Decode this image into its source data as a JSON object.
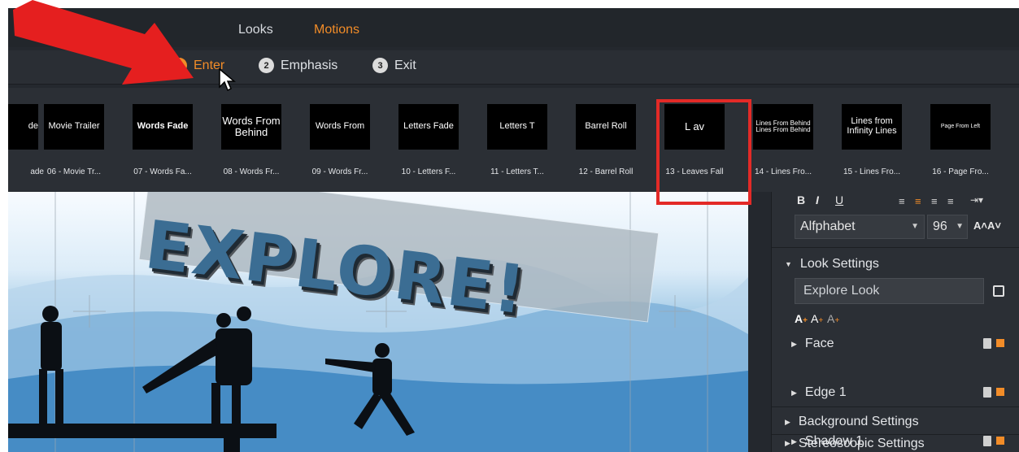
{
  "top_tabs": [
    "Looks",
    "Motions"
  ],
  "active_top_tab": "Motions",
  "categories": [
    {
      "num": "1",
      "label": "Enter"
    },
    {
      "num": "2",
      "label": "Emphasis"
    },
    {
      "num": "3",
      "label": "Exit"
    }
  ],
  "thumbnails": [
    {
      "image_text": "de",
      "caption": "ade"
    },
    {
      "image_text": "Movie Trailer",
      "caption": "06 - Movie Tr..."
    },
    {
      "image_text": "Words Fade",
      "caption": "07 - Words Fa..."
    },
    {
      "image_text": "Words From Behind",
      "caption": "08 - Words Fr..."
    },
    {
      "image_text": "Words From",
      "caption": "09 - Words Fr..."
    },
    {
      "image_text": "Letters Fade",
      "caption": "10 - Letters F..."
    },
    {
      "image_text": "Letters T",
      "caption": "11 - Letters T..."
    },
    {
      "image_text": "Barrel Roll",
      "caption": "12 - Barrel Roll"
    },
    {
      "image_text": "L av",
      "caption": "13 - Leaves Fall"
    },
    {
      "image_text": "Lines From Behind Lines From Behind",
      "caption": "14 - Lines Fro..."
    },
    {
      "image_text": "Lines from Infinity Lines",
      "caption": "15 - Lines Fro..."
    },
    {
      "image_text": "Page From Left",
      "caption": "16 - Page Fro..."
    }
  ],
  "preview": {
    "title_text": "EXPLORE!"
  },
  "side_panel": {
    "font_name": "Alfphabet",
    "font_size": "96",
    "look_settings_label": "Look Settings",
    "look_name": "Explore Look",
    "tree": [
      "Face",
      "Edge 1",
      "Shadow 1"
    ],
    "background_settings_label": "Background Settings",
    "stereoscopic_settings_label": "Stereoscopic Settings"
  },
  "colors": {
    "accent": "#f28c28",
    "highlight_red": "#e32a27"
  }
}
